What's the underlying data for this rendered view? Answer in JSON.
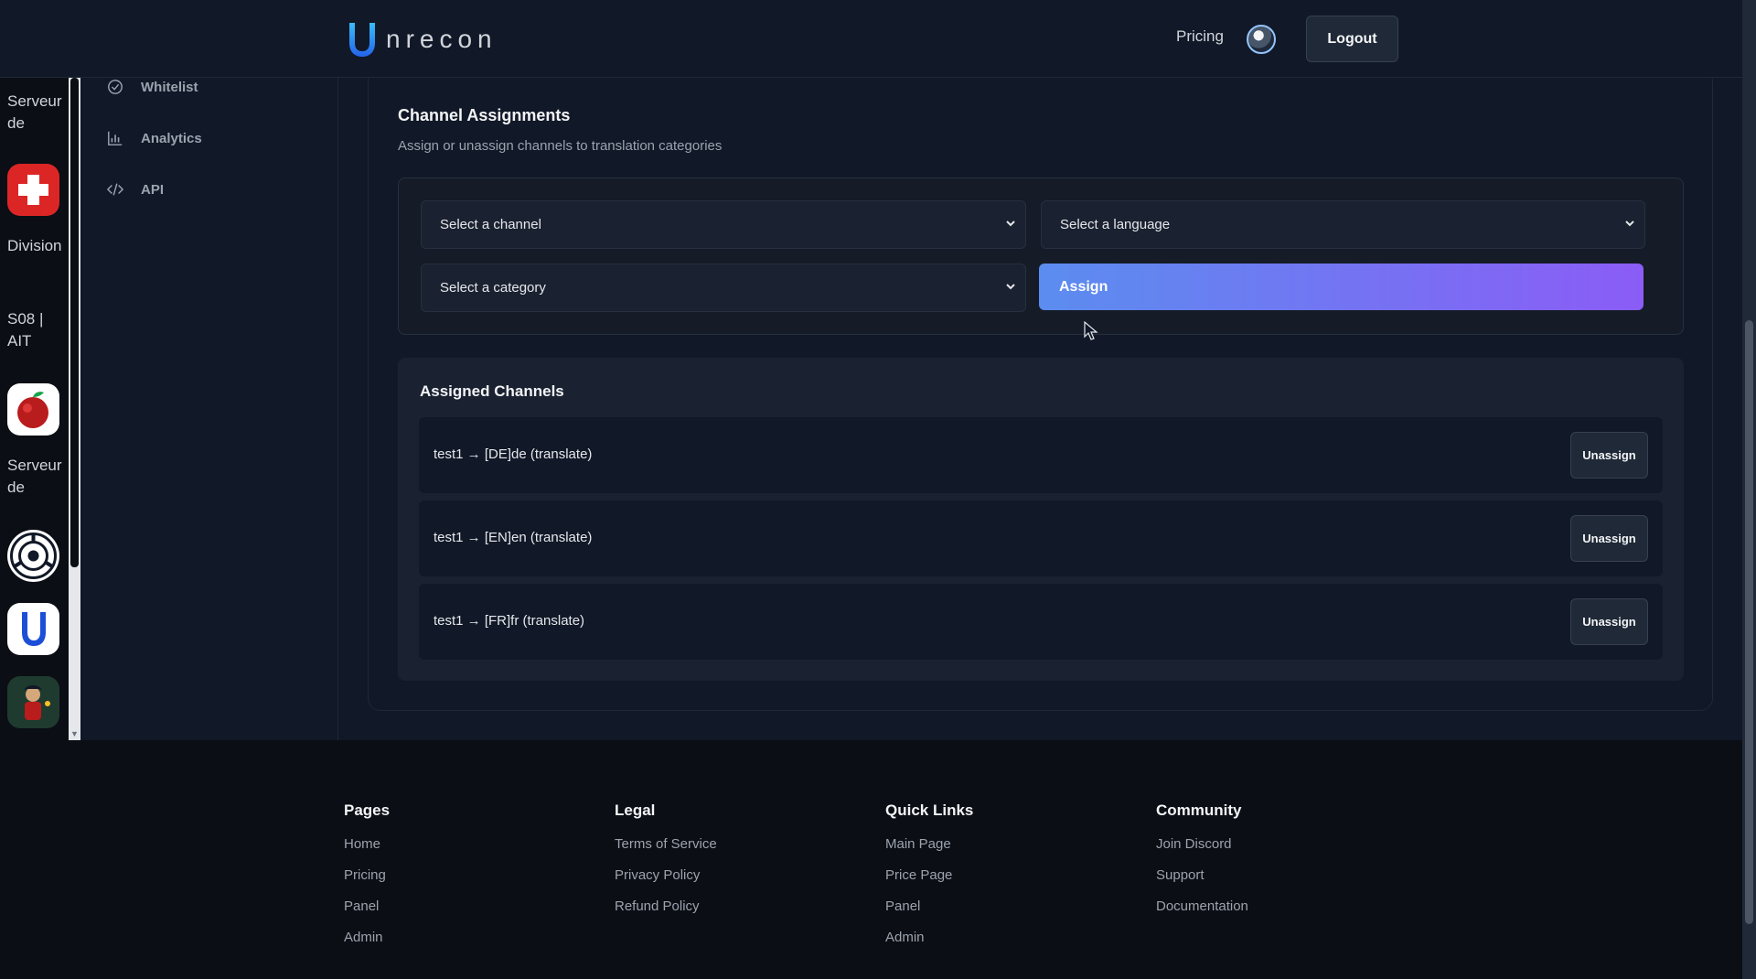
{
  "header": {
    "brand": "nrecon",
    "nav_pricing": "Pricing",
    "logout_label": "Logout"
  },
  "rail": {
    "items": [
      {
        "label": "Serveur de",
        "kind": "text"
      },
      {
        "label": "",
        "kind": "icon",
        "icon": "swiss-cross-icon",
        "color": "#dc2626"
      },
      {
        "label": "Division",
        "kind": "text"
      },
      {
        "label": "S08 | AIT",
        "kind": "text"
      },
      {
        "label": "",
        "kind": "icon",
        "icon": "apple-icon",
        "color": "#ffffff"
      },
      {
        "label": "Serveur de",
        "kind": "text"
      },
      {
        "label": "",
        "kind": "icon",
        "icon": "scp-logo-icon",
        "color": "#ffffff"
      },
      {
        "label": "",
        "kind": "icon",
        "icon": "unrecon-logo-icon",
        "color": "#ffffff"
      },
      {
        "label": "",
        "kind": "icon",
        "icon": "character-avatar-icon",
        "color": "#1e293b"
      }
    ]
  },
  "sidebar": {
    "items": [
      {
        "label": "Whitelist",
        "icon": "check-circle-icon"
      },
      {
        "label": "Analytics",
        "icon": "bar-chart-icon"
      },
      {
        "label": "API",
        "icon": "code-icon"
      }
    ]
  },
  "channel_assignments": {
    "title": "Channel Assignments",
    "subtitle": "Assign or unassign channels to translation categories",
    "channel_select": "Select a channel",
    "language_select": "Select a language",
    "category_select": "Select a category",
    "assign_label": "Assign"
  },
  "assigned_channels": {
    "title": "Assigned Channels",
    "unassign_label": "Unassign",
    "rows": [
      {
        "text": "test1 → [DE]de (translate)"
      },
      {
        "text": "test1 → [EN]en (translate)"
      },
      {
        "text": "test1 → [FR]fr (translate)"
      }
    ]
  },
  "footer": {
    "columns": [
      {
        "title": "Pages",
        "links": [
          "Home",
          "Pricing",
          "Panel",
          "Admin"
        ]
      },
      {
        "title": "Legal",
        "links": [
          "Terms of Service",
          "Privacy Policy",
          "Refund Policy"
        ]
      },
      {
        "title": "Quick Links",
        "links": [
          "Main Page",
          "Price Page",
          "Panel",
          "Admin"
        ]
      },
      {
        "title": "Community",
        "links": [
          "Join Discord",
          "Support",
          "Documentation"
        ]
      }
    ]
  },
  "colors": {
    "background": "#111827",
    "accent_start": "#5b8def",
    "accent_end": "#8b5cf6"
  }
}
